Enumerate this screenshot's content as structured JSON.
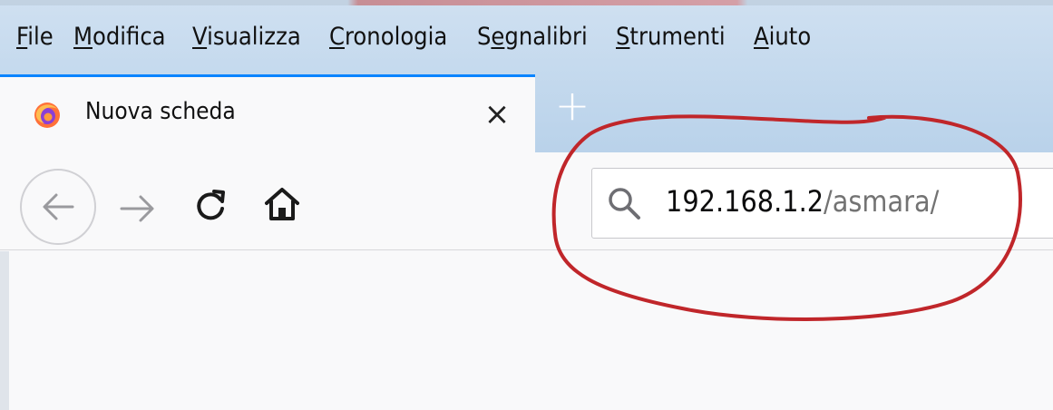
{
  "menubar": {
    "items": [
      {
        "key": "F",
        "rest": "ile"
      },
      {
        "key": "M",
        "rest": "odifica"
      },
      {
        "key": "V",
        "rest": "isualizza"
      },
      {
        "key": "C",
        "rest": "ronologia"
      },
      {
        "pre": "S",
        "key": "e",
        "rest": "gnalibri"
      },
      {
        "key": "S",
        "rest": "trumenti"
      },
      {
        "key": "A",
        "rest": "iuto"
      }
    ]
  },
  "tab": {
    "title": "Nuova scheda",
    "favicon": "firefox-icon",
    "close_glyph": "×"
  },
  "new_tab_glyph": "+",
  "navbar": {
    "back_icon": "back-arrow-icon",
    "forward_icon": "forward-arrow-icon",
    "reload_icon": "reload-icon",
    "home_icon": "home-icon"
  },
  "urlbar": {
    "host": "192.168.1.2",
    "path": "/asmara/",
    "search_icon": "search-icon"
  },
  "colors": {
    "accent": "#0a84ff",
    "annotation": "#c0262a",
    "chrome": "#c4d9ee"
  }
}
